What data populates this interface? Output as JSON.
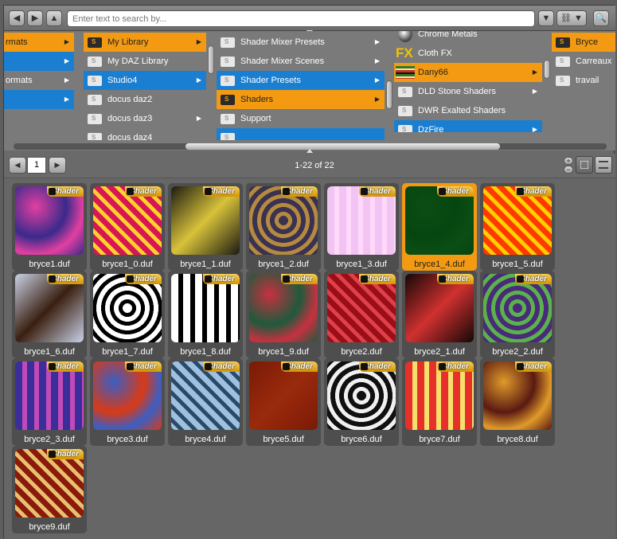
{
  "toolbar": {
    "back_icon": "arrow-left-icon",
    "forward_icon": "arrow-right-icon",
    "up_icon": "arrow-up-icon",
    "search_placeholder": "Enter text to search by...",
    "search_value": ""
  },
  "columns": {
    "col1": [
      {
        "label": "rmats",
        "state": "orange",
        "arrow": true
      },
      {
        "label": "",
        "state": "blue",
        "arrow": true
      },
      {
        "label": "ormats",
        "state": "none",
        "arrow": true
      },
      {
        "label": "",
        "state": "blue",
        "arrow": true
      }
    ],
    "col2": [
      {
        "label": "My Library",
        "state": "orange",
        "arrow": true,
        "dark": true
      },
      {
        "label": "My DAZ Library",
        "state": "none",
        "arrow": false
      },
      {
        "label": "Studio4",
        "state": "blue",
        "arrow": true
      },
      {
        "label": "docus daz2",
        "state": "none",
        "arrow": false
      },
      {
        "label": "docus daz3",
        "state": "none",
        "arrow": true
      },
      {
        "label": "docus daz4",
        "state": "none",
        "arrow": false
      }
    ],
    "col3": [
      {
        "label": "Shader Mixer Presets",
        "state": "none",
        "arrow": true
      },
      {
        "label": "Shader Mixer Scenes",
        "state": "none",
        "arrow": true
      },
      {
        "label": "Shader Presets",
        "state": "blue",
        "arrow": true
      },
      {
        "label": "Shaders",
        "state": "orange",
        "arrow": true,
        "dark": true
      },
      {
        "label": "Support",
        "state": "none",
        "arrow": false
      },
      {
        "label": "",
        "state": "blue",
        "arrow": false
      }
    ],
    "col4": [
      {
        "label": "Chrome Metals",
        "state": "none",
        "arrow": false,
        "icon": "chrome"
      },
      {
        "label": "Cloth FX",
        "state": "none",
        "arrow": false,
        "icon": "fx"
      },
      {
        "label": "Dany66",
        "state": "orange",
        "arrow": true,
        "icon": "stripes"
      },
      {
        "label": "DLD Stone Shaders",
        "state": "none",
        "arrow": true
      },
      {
        "label": "DWR Exalted Shaders",
        "state": "none",
        "arrow": false
      },
      {
        "label": "DzFire",
        "state": "blue",
        "arrow": true
      }
    ],
    "col5": [
      {
        "label": "Bryce",
        "state": "orange",
        "arrow": false,
        "dark": true
      },
      {
        "label": "Carreaux",
        "state": "none",
        "arrow": false
      },
      {
        "label": "travail",
        "state": "none",
        "arrow": false
      }
    ]
  },
  "pager": {
    "page": "1",
    "count_text": "1-22 of 22",
    "prev_icon": "arrow-left-icon",
    "next_icon": "arrow-right-icon"
  },
  "badge_label": "Shader",
  "tiles": [
    {
      "name": "bryce1.duf",
      "c1": "#3a2a8c",
      "c2": "#e23fa0",
      "selected": false
    },
    {
      "name": "bryce1_0.duf",
      "c1": "#d81555",
      "c2": "#ffd22b",
      "selected": false
    },
    {
      "name": "bryce1_1.duf",
      "c1": "#1b1b12",
      "c2": "#d8c23a",
      "selected": false
    },
    {
      "name": "bryce1_2.duf",
      "c1": "#3b3150",
      "c2": "#b48a40",
      "selected": false
    },
    {
      "name": "bryce1_3.duf",
      "c1": "#f1c4f4",
      "c2": "#ffd8fa",
      "selected": false
    },
    {
      "name": "bryce1_4.duf",
      "c1": "#064510",
      "c2": "#0b4e14",
      "selected": true
    },
    {
      "name": "bryce1_5.duf",
      "c1": "#ff3a00",
      "c2": "#ffd000",
      "selected": false
    },
    {
      "name": "bryce1_6.duf",
      "c1": "#c8d2e6",
      "c2": "#3a1f10",
      "selected": false
    },
    {
      "name": "bryce1_7.duf",
      "c1": "#ffffff",
      "c2": "#000000",
      "selected": false
    },
    {
      "name": "bryce1_8.duf",
      "c1": "#ffffff",
      "c2": "#000000",
      "selected": false
    },
    {
      "name": "bryce1_9.duf",
      "c1": "#1e5a3c",
      "c2": "#c83040",
      "selected": false
    },
    {
      "name": "bryce2.duf",
      "c1": "#9a0f17",
      "c2": "#e0404a",
      "selected": false
    },
    {
      "name": "bryce2_1.duf",
      "c1": "#140806",
      "c2": "#d03030",
      "selected": false
    },
    {
      "name": "bryce2_2.duf",
      "c1": "#4a2a7a",
      "c2": "#5ab24a",
      "selected": false
    },
    {
      "name": "bryce2_3.duf",
      "c1": "#3b2d9a",
      "c2": "#c04ab8",
      "selected": false
    },
    {
      "name": "bryce3.duf",
      "c1": "#d83a16",
      "c2": "#3b5ec4",
      "selected": false
    },
    {
      "name": "bryce4.duf",
      "c1": "#9fc0de",
      "c2": "#2a4a6a",
      "selected": false
    },
    {
      "name": "bryce5.duf",
      "c1": "#7a1a06",
      "c2": "#9a2a0c",
      "selected": false
    },
    {
      "name": "bryce6.duf",
      "c1": "#101010",
      "c2": "#f0f0f0",
      "selected": false
    },
    {
      "name": "bryce7.duf",
      "c1": "#e8302a",
      "c2": "#f4e06a",
      "selected": false
    },
    {
      "name": "bryce8.duf",
      "c1": "#5a1a12",
      "c2": "#e09a2a",
      "selected": false
    },
    {
      "name": "bryce9.duf",
      "c1": "#8a1a0a",
      "c2": "#e8c070",
      "selected": false
    }
  ]
}
